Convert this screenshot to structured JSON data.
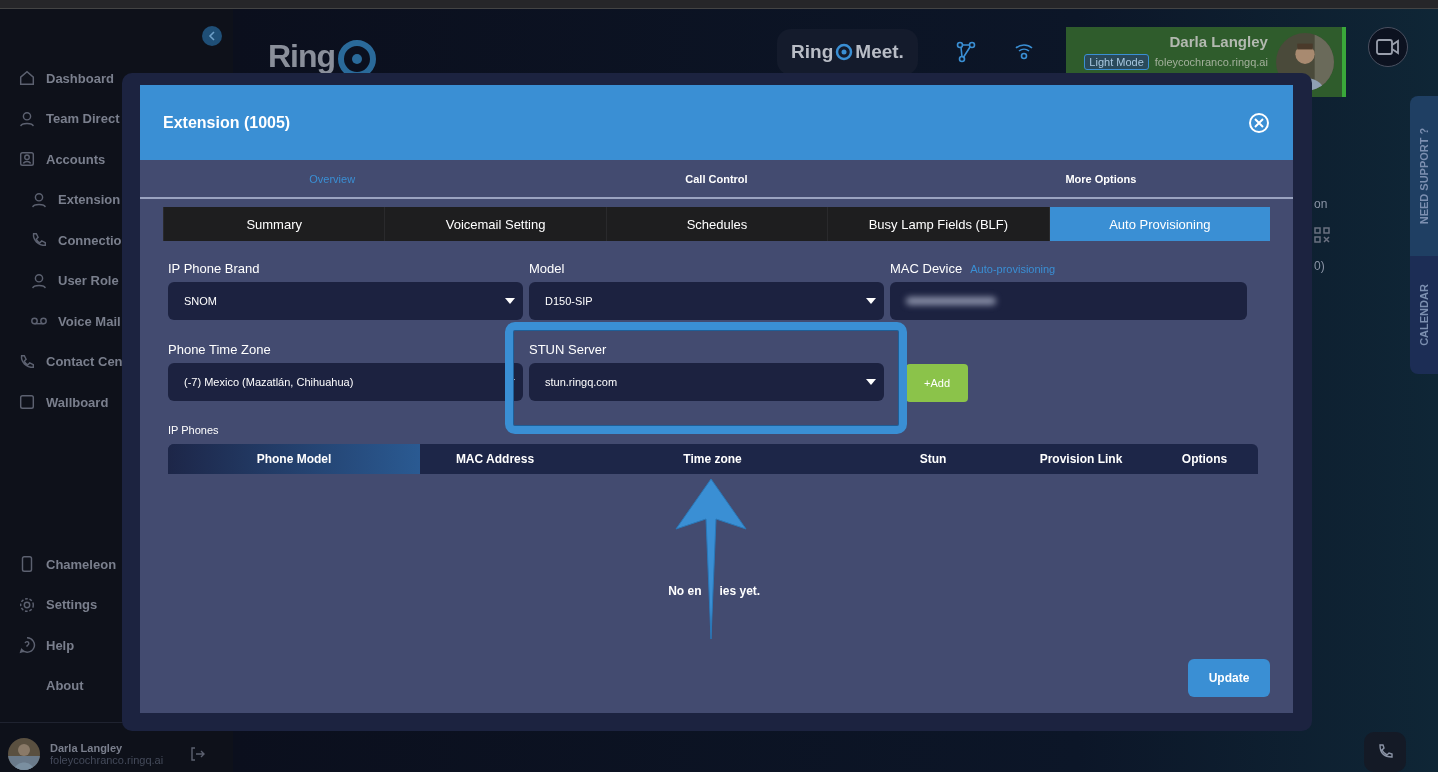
{
  "sidebar": {
    "items": [
      {
        "label": "Dashboard"
      },
      {
        "label": "Team Direct"
      },
      {
        "label": "Accounts",
        "children": [
          {
            "label": "Extension"
          },
          {
            "label": "Connectio"
          },
          {
            "label": "User Role"
          },
          {
            "label": "Voice Mail"
          }
        ]
      },
      {
        "label": "Contact Cen"
      },
      {
        "label": "Wallboard"
      }
    ],
    "bottom_items": [
      {
        "label": "Chameleon"
      },
      {
        "label": "Settings"
      },
      {
        "label": "Help"
      },
      {
        "label": "About"
      }
    ],
    "user": {
      "name": "Darla Langley",
      "email": "foleycochranco.ringq.ai"
    }
  },
  "topbar": {
    "logo": "Ring",
    "meet_logo": {
      "left": "Ring",
      "right": "Meet."
    },
    "user_card": {
      "name": "Darla Langley",
      "mode": "Light Mode",
      "email": "foleycochranco.ringq.ai"
    }
  },
  "right_rail": {
    "tabs": [
      "NEED SUPPORT ?",
      "CALENDAR"
    ],
    "fragments": [
      "on",
      "0)"
    ]
  },
  "modal": {
    "title": "Extension (1005)",
    "top_tabs": [
      {
        "label": "Overview",
        "selected": true
      },
      {
        "label": "Call Control",
        "selected": false
      },
      {
        "label": "More Options",
        "selected": false
      }
    ],
    "sub_tabs": [
      {
        "label": "Summary",
        "selected": false
      },
      {
        "label": "Voicemail Setting",
        "selected": false
      },
      {
        "label": "Schedules",
        "selected": false
      },
      {
        "label": "Busy Lamp Fields (BLF)",
        "selected": false
      },
      {
        "label": "Auto Provisioning",
        "selected": true
      }
    ],
    "fields": [
      {
        "kind": "select",
        "label": "IP Phone Brand",
        "value": "SNOM",
        "highlighted": false
      },
      {
        "kind": "select",
        "label": "Model",
        "value": "D150-SIP",
        "highlighted": false
      },
      {
        "kind": "blurred",
        "label": "MAC Device",
        "hint": "Auto-provisioning",
        "highlighted": false
      },
      {
        "kind": "select",
        "label": "Phone Time Zone",
        "value": "(-7) Mexico (Mazatlán, Chihuahua)",
        "highlighted": false
      },
      {
        "kind": "select",
        "label": "STUN Server",
        "value": "stun.ringq.com",
        "highlighted": true
      },
      {
        "kind": "button",
        "label": "+Add",
        "highlighted": false
      }
    ],
    "table": {
      "title": "IP Phones",
      "columns": [
        "Phone Model",
        "MAC Address",
        "Time zone",
        "Stun",
        "Provision Link",
        "Options"
      ],
      "empty": [
        "No en",
        "ies yet."
      ]
    },
    "update": "Update"
  }
}
